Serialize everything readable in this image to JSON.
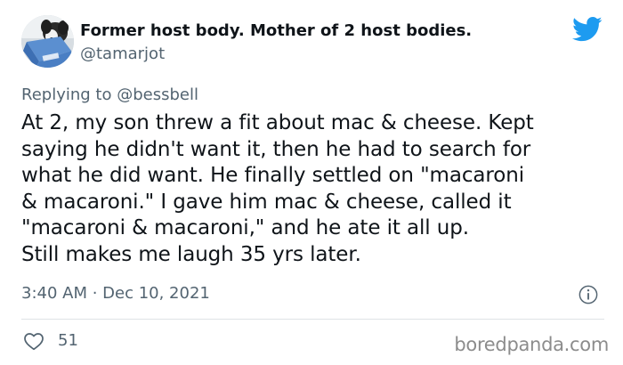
{
  "tweet": {
    "display_name": "Former host body. Mother of 2 host bodies.",
    "handle": "@tamarjot",
    "replying_prefix": "Replying to",
    "replying_to": "@bessbell",
    "text_lines": [
      "At 2, my son threw a fit about mac & cheese. Kept",
      "saying he didn't want it, then he had to search for",
      "what he did want. He finally settled on \"macaroni",
      "& macaroni.\" I gave him mac & cheese, called it",
      "\"macaroni & macaroni,\" and he ate it all up.",
      "Still makes me laugh 35 yrs later."
    ],
    "timestamp": "3:40 AM · Dec 10, 2021",
    "like_count": "51"
  },
  "icons": {
    "brand": "twitter-bird-icon",
    "info": "info-icon",
    "like": "heart-icon"
  },
  "colors": {
    "twitter_blue": "#1d9bf0",
    "secondary_text": "#536471",
    "primary_text": "#0f1419"
  },
  "watermark": {
    "text": "boredpanda.com"
  }
}
